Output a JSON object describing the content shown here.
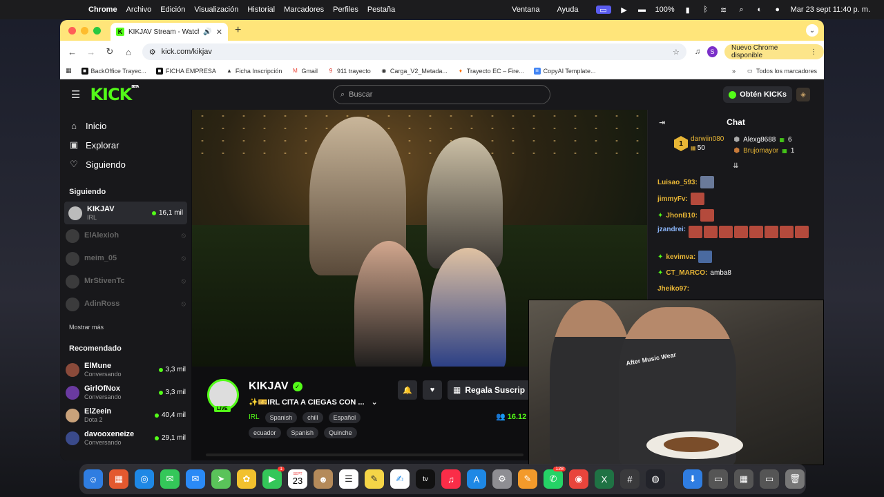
{
  "menubar": {
    "app_name": "Chrome",
    "menus": [
      "Archivo",
      "Edición",
      "Visualización",
      "Historial",
      "Marcadores",
      "Perfiles",
      "Pestaña",
      "Ventana",
      "Ayuda"
    ],
    "battery": "100%",
    "datetime": "Mar 23 sept 11:40 p. m."
  },
  "browser": {
    "tab_title": "KIKJAV Stream - Watch Li",
    "url": "kick.com/kikjav",
    "profile_initial": "S",
    "update_label": "Nuevo Chrome disponible",
    "bookmarks": [
      {
        "label": "BackOffice Trayec...",
        "color": "#111111"
      },
      {
        "label": "FICHA EMPRESA",
        "color": "#111111"
      },
      {
        "label": "Ficha Inscripción",
        "color": "#222222"
      },
      {
        "label": "Gmail",
        "color": "#ea4335"
      },
      {
        "label": "911 trayecto",
        "color": "#d93025"
      },
      {
        "label": "Carga_V2_Metada...",
        "color": "#444444"
      },
      {
        "label": "Trayecto EC – Fire...",
        "color": "#ff6d00"
      },
      {
        "label": "CopyAI Template...",
        "color": "#4285f4"
      }
    ],
    "all_bookmarks_label": "Todos los marcadores"
  },
  "kick": {
    "logo": "KICK",
    "logo_sup": "BETA",
    "search_placeholder": "Buscar",
    "get_kicks_label": "Obtén KICKs",
    "nav": [
      {
        "label": "Inicio",
        "icon": "⌂"
      },
      {
        "label": "Explorar",
        "icon": "▣"
      },
      {
        "label": "Siguiendo",
        "icon": "♡"
      }
    ],
    "following_title": "Siguiendo",
    "following": [
      {
        "name": "KIKJAV",
        "category": "IRL",
        "viewers": "16,1 mil",
        "live": true
      },
      {
        "name": "ElAlexioh",
        "live": false
      },
      {
        "name": "meim_05",
        "live": false
      },
      {
        "name": "MrStivenTc",
        "live": false
      },
      {
        "name": "AdinRoss",
        "live": false
      }
    ],
    "show_more": "Mostrar más",
    "recommended_title": "Recomendado",
    "recommended": [
      {
        "name": "ElMune",
        "category": "Conversando",
        "viewers": "3,3 mil",
        "avatar": "#8a4a3a"
      },
      {
        "name": "GirlOfNox",
        "category": "Conversando",
        "viewers": "3,3 mil",
        "avatar": "#6a3aa0"
      },
      {
        "name": "ElZeein",
        "category": "Dota 2",
        "viewers": "40,4 mil",
        "avatar": "#c9a27a"
      },
      {
        "name": "davooxeneize",
        "category": "Conversando",
        "viewers": "29,1 mil",
        "avatar": "#3a4a8a"
      }
    ]
  },
  "stream": {
    "streamer": "KIKJAV",
    "live_label": "LIVE",
    "title": "✨🎫IRL CITA A CIEGAS CON ...",
    "category": "IRL",
    "tags": [
      "Spanish",
      "chill",
      "Español",
      "ecuador",
      "Spanish",
      "Quinche"
    ],
    "subscribe_label": "Regala Suscrip",
    "viewers": "16.12"
  },
  "chat": {
    "title": "Chat",
    "leaderboard": {
      "first": {
        "rank": "1",
        "name": "darwiin080",
        "gifts": "50"
      },
      "others": [
        {
          "name": "Alexg8688",
          "gifts": "6",
          "color": "#dddddd"
        },
        {
          "name": "Brujomayor",
          "gifts": "1",
          "color": "#e8b636"
        }
      ]
    },
    "messages": [
      {
        "user": "Luisao_593:",
        "color": "#e8b636",
        "og": false,
        "text": "",
        "emotes": 1
      },
      {
        "user": "jimmyFv:",
        "color": "#e8b636",
        "og": false,
        "text": "",
        "emotes": 1
      },
      {
        "user": "JhonB10:",
        "color": "#e8b636",
        "og": true,
        "text": "",
        "emotes": 1
      },
      {
        "user": "jzandrei:",
        "color": "#8ab4f8",
        "og": false,
        "text": "",
        "emotes": 8
      },
      {
        "user": "kevimva:",
        "color": "#e8b636",
        "og": true,
        "text": "",
        "emotes": 1
      },
      {
        "user": "CT_MARCO:",
        "color": "#e8b636",
        "og": true,
        "text": "amba8",
        "emotes": 0
      },
      {
        "user": "Jheiko97:",
        "color": "#e8b636",
        "og": false,
        "text": "",
        "emotes": 0
      }
    ]
  },
  "pip": {
    "shirt_text": "After Music Wear"
  },
  "dock": {
    "apps": [
      {
        "name": "finder",
        "glyph": "☺",
        "color": "#2f7de1"
      },
      {
        "name": "launchpad",
        "glyph": "▦",
        "color": "#e3592f"
      },
      {
        "name": "safari",
        "glyph": "◎",
        "color": "#1e88e5"
      },
      {
        "name": "messages",
        "glyph": "✉",
        "color": "#34c759"
      },
      {
        "name": "mail",
        "glyph": "✉",
        "color": "#2a8af6"
      },
      {
        "name": "maps",
        "glyph": "➤",
        "color": "#5ac35a"
      },
      {
        "name": "photos",
        "glyph": "✿",
        "color": "#f2c12e"
      },
      {
        "name": "facetime",
        "glyph": "▶",
        "color": "#34c759",
        "badge": "1"
      },
      {
        "name": "calendar",
        "glyph": "",
        "color": "#ffffff",
        "month": "SEPT",
        "day": "23"
      },
      {
        "name": "contacts",
        "glyph": "☻",
        "color": "#b48a5a"
      },
      {
        "name": "reminders",
        "glyph": "☰",
        "color": "#ffffff"
      },
      {
        "name": "notes",
        "glyph": "✎",
        "color": "#f5d547"
      },
      {
        "name": "freeform",
        "glyph": "✍",
        "color": "#ffffff"
      },
      {
        "name": "tv",
        "glyph": "tv",
        "color": "#111111"
      },
      {
        "name": "music",
        "glyph": "♫",
        "color": "#fa2d48"
      },
      {
        "name": "app-store",
        "glyph": "A",
        "color": "#1e88e5"
      },
      {
        "name": "system-settings",
        "glyph": "⚙",
        "color": "#8e8e93"
      },
      {
        "name": "pages",
        "glyph": "✎",
        "color": "#f39a2b"
      },
      {
        "name": "whatsapp",
        "glyph": "✆",
        "color": "#25d366",
        "badge": "128"
      },
      {
        "name": "chrome",
        "glyph": "◉",
        "color": "#e8453c"
      },
      {
        "name": "excel",
        "glyph": "X",
        "color": "#1f7244"
      },
      {
        "name": "calculator",
        "glyph": "#",
        "color": "#3a3a3c"
      },
      {
        "name": "obs",
        "glyph": "◍",
        "color": "#22232a"
      }
    ],
    "extras": [
      {
        "name": "downloads",
        "glyph": "⬇",
        "color": "#2f7de1"
      },
      {
        "name": "window-1",
        "glyph": "▭",
        "color": "#555555"
      },
      {
        "name": "window-2",
        "glyph": "▦",
        "color": "#555555"
      },
      {
        "name": "window-3",
        "glyph": "▭",
        "color": "#555555"
      },
      {
        "name": "trash",
        "glyph": "🗑",
        "color": "#777777"
      }
    ]
  }
}
